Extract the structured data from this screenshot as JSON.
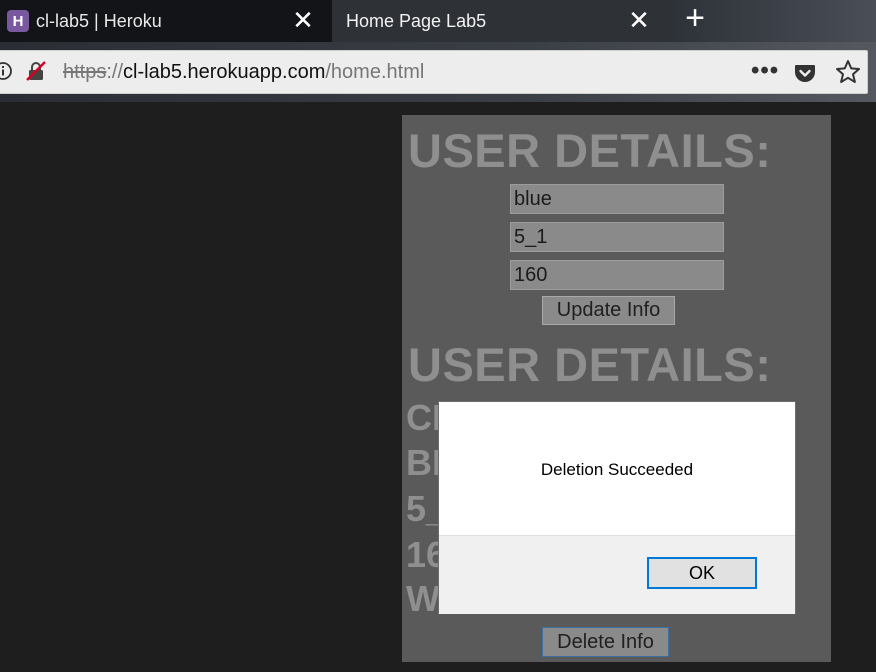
{
  "browser": {
    "tabs": [
      {
        "title": "cl-lab5 | Heroku",
        "favicon": "H"
      },
      {
        "title": "Home Page Lab5"
      }
    ],
    "new_tab_label": "+",
    "url": {
      "scheme": "https",
      "separator": "://",
      "host": "cl-lab5.herokuapp.com",
      "path": "/home.html"
    },
    "more_label": "•••"
  },
  "page": {
    "heading1": "USER DETAILS:",
    "fields": [
      "blue",
      "5_1",
      "160"
    ],
    "update_button": "Update Info",
    "heading2": "USER DETAILS:",
    "details": [
      "CI",
      "BI",
      "5_",
      "16",
      "W"
    ],
    "delete_button": "Delete Info"
  },
  "dialog": {
    "message": "Deletion Succeeded",
    "ok_label": "OK"
  }
}
